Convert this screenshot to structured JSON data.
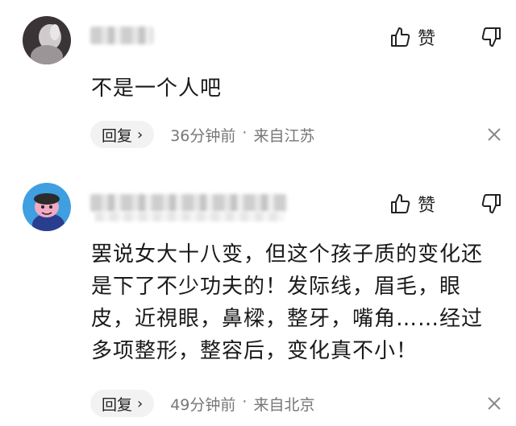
{
  "comments": [
    {
      "text": "不是一个人吧",
      "like_label": "赞",
      "reply_label": "回复",
      "time": "36分钟前",
      "separator": "·",
      "location": "来自江苏",
      "avatar_icon": "user-avatar-photo"
    },
    {
      "text": "罢说女大十八变，但这个孩子质的变化还是下了不少功夫的！发际线，眉毛，眼皮，近視眼，鼻樑，整牙，嘴角……经过多项整形，整容后，变化真不小！",
      "like_label": "赞",
      "reply_label": "回复",
      "time": "49分钟前",
      "separator": "·",
      "location": "来自北京",
      "avatar_icon": "cartoon-avatar"
    }
  ],
  "colors": {
    "meta_text": "#777777",
    "reply_bg": "#f2f2f2",
    "avatar2_bg": "#3f9fe0"
  }
}
